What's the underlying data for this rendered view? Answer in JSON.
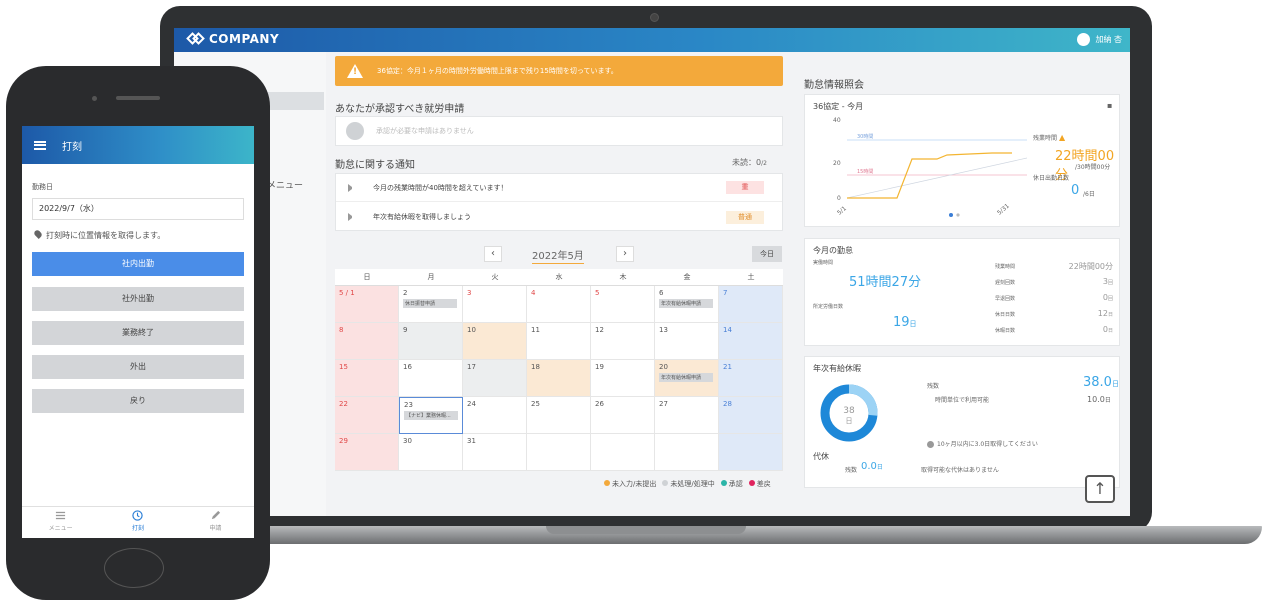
{
  "header": {
    "logo_text": "COMPANY",
    "user_name": "加納 杏"
  },
  "sidebar": {
    "items": [
      "...",
      "",
      "用メニュー"
    ]
  },
  "alert": {
    "text": "36協定：今月１ヶ月の時間外労働時間上限まで残り15時間を切っています。"
  },
  "approval": {
    "title": "あなたが承認すべき就労申請",
    "empty_text": "承認が必要な申請はありません"
  },
  "notices": {
    "title": "勤怠に関する通知",
    "unread_label": "未読：0",
    "unread_total": "/2",
    "items": [
      {
        "text": "今月の残業時間が40時間を超えています！",
        "tag": "重",
        "tag_color": "#fde2e2",
        "tag_text_color": "#e04848"
      },
      {
        "text": "年次有給休暇を取得しましょう",
        "tag": "普通",
        "tag_color": "#fcefdc",
        "tag_text_color": "#e08d2a"
      }
    ]
  },
  "calendar": {
    "month_label": "2022年5月",
    "prev": "‹",
    "next": "›",
    "today_label": "今日",
    "weekdays": [
      "日",
      "月",
      "火",
      "水",
      "木",
      "金",
      "土"
    ],
    "cells": [
      {
        "day": "5 / 1",
        "kind": "sun"
      },
      {
        "day": "2",
        "pill": "休日振替申請"
      },
      {
        "day": "3",
        "kind": "red"
      },
      {
        "day": "4",
        "kind": "red"
      },
      {
        "day": "5",
        "kind": "red"
      },
      {
        "day": "6",
        "pill": "年次有給休暇申請"
      },
      {
        "day": "7",
        "kind": "sat"
      },
      {
        "day": "8",
        "kind": "sun"
      },
      {
        "day": "9",
        "kind": "gray"
      },
      {
        "day": "10",
        "kind": "beige"
      },
      {
        "day": "11"
      },
      {
        "day": "12"
      },
      {
        "day": "13"
      },
      {
        "day": "14",
        "kind": "sat"
      },
      {
        "day": "15",
        "kind": "sun"
      },
      {
        "day": "16"
      },
      {
        "day": "17",
        "kind": "gray"
      },
      {
        "day": "18",
        "kind": "beige"
      },
      {
        "day": "19"
      },
      {
        "day": "20",
        "kind": "beige",
        "pill": "年次有給休暇申請"
      },
      {
        "day": "21",
        "kind": "sat"
      },
      {
        "day": "22",
        "kind": "sun"
      },
      {
        "day": "23",
        "kind": "sel",
        "pill": "【ナビ】業務休暇..."
      },
      {
        "day": "24"
      },
      {
        "day": "25"
      },
      {
        "day": "26"
      },
      {
        "day": "27"
      },
      {
        "day": "28",
        "kind": "sat"
      },
      {
        "day": "29",
        "kind": "sun"
      },
      {
        "day": "30"
      },
      {
        "day": "31"
      },
      {
        "day": ""
      },
      {
        "day": ""
      },
      {
        "day": ""
      },
      {
        "day": "",
        "kind": "sat"
      }
    ],
    "legend": [
      {
        "label": "未入力/未提出",
        "color": "#f3a93b"
      },
      {
        "label": "未処理/処理中",
        "color": "#cfd2d5"
      },
      {
        "label": "承認",
        "color": "#2bb5a8"
      },
      {
        "label": "差戻",
        "color": "#e0245e"
      }
    ]
  },
  "attendance": {
    "title": "勤怠情報照会",
    "agreement": {
      "title": "36協定 - 今月",
      "y_ticks": [
        "40",
        "20",
        "0"
      ],
      "limit_30_label": "30時間",
      "limit_15_label": "15時間",
      "x_start": "5/1",
      "x_end": "5/31",
      "overtime_label": "残業時間",
      "overtime_value": "22時間00分",
      "overtime_limit": "/30時間00分",
      "holiday_work_label": "休日出勤日数",
      "holiday_work_value": "0",
      "holiday_work_unit": "/6日"
    },
    "month": {
      "title": "今月の勤怠",
      "actual_label": "実働時間",
      "actual_value": "51時間27分",
      "scheduled_label": "所定労働日数",
      "scheduled_value": "19",
      "scheduled_unit": "日",
      "rows": [
        {
          "label": "残業時間",
          "value": "22時間00分"
        },
        {
          "label": "遅刻回数",
          "value": "3",
          "unit": "回"
        },
        {
          "label": "早退回数",
          "value": "0",
          "unit": "回"
        },
        {
          "label": "休日日数",
          "value": "12",
          "unit": "日"
        },
        {
          "label": "休暇日数",
          "value": "0",
          "unit": "日"
        }
      ]
    },
    "leave": {
      "title": "年次有給休暇",
      "ring_value": "38",
      "ring_unit": "日",
      "remaining_label": "残数",
      "remaining_value": "38.0",
      "remaining_unit": "日",
      "hourly_label": "時間単位で利用可能",
      "hourly_value": "10.0",
      "hourly_unit": "日",
      "hint": "10ヶ月以内に3.0日取得してください",
      "sub_title": "代休",
      "sub_label": "残数",
      "sub_value": "0.0",
      "sub_unit": "日",
      "sub_note": "取得可能な代休はありません"
    }
  },
  "phone": {
    "title": "打刻",
    "date_label": "勤務日",
    "date_value": "2022/9/7（水）",
    "location_note": "打刻時に位置情報を取得します。",
    "buttons": [
      "社内出勤",
      "社外出勤",
      "業務終了",
      "外出",
      "戻り"
    ],
    "nav": [
      "メニュー",
      "打刻",
      "申請"
    ]
  },
  "up_button": "↑"
}
